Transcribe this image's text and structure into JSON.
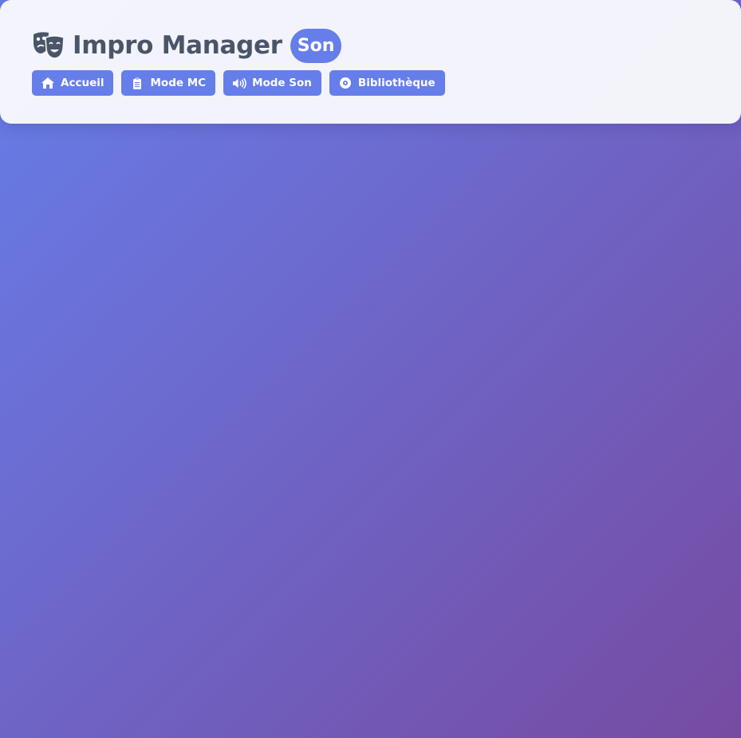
{
  "header": {
    "title": "Impro Manager",
    "mode_badge": "Son",
    "title_icon": "theater-masks-icon"
  },
  "nav": {
    "items": [
      {
        "label": "Accueil",
        "icon": "home-icon"
      },
      {
        "label": "Mode MC",
        "icon": "clipboard-icon"
      },
      {
        "label": "Mode Son",
        "icon": "speaker-icon"
      },
      {
        "label": "Bibliothèque",
        "icon": "disc-icon"
      }
    ]
  },
  "colors": {
    "accent": "#667eea",
    "background_start": "#667eea",
    "background_end": "#764ba2",
    "title_text": "#4a5568",
    "header_bg": "#f8f8fc"
  }
}
